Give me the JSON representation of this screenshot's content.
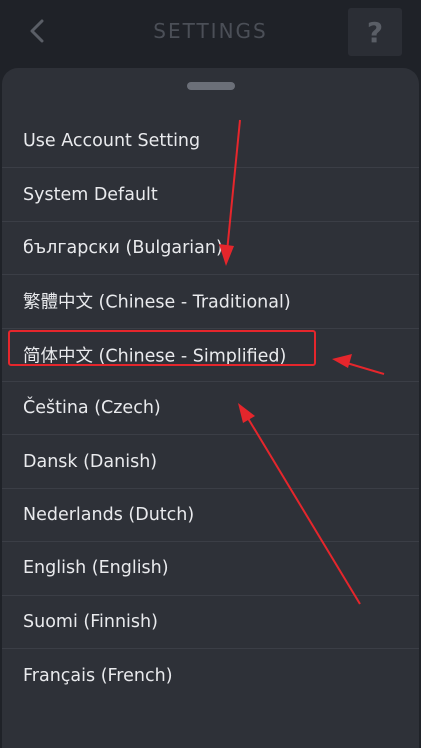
{
  "header": {
    "title": "SETTINGS",
    "help_label": "?"
  },
  "sheet": {
    "languages": [
      "Use Account Setting",
      "System Default",
      "български (Bulgarian)",
      "繁體中文 (Chinese - Traditional)",
      "简体中文 (Chinese - Simplified)",
      "Čeština (Czech)",
      "Dansk (Danish)",
      "Nederlands (Dutch)",
      "English (English)",
      "Suomi (Finnish)",
      "Français (French)"
    ]
  },
  "annotation": {
    "highlighted_item": "简体中文 (Chinese - Simplified)",
    "color": "#e5262c"
  },
  "colors": {
    "background": "#1f2228",
    "sheet": "#2e3138",
    "text": "#e9eaed",
    "title": "#4b4f57"
  }
}
